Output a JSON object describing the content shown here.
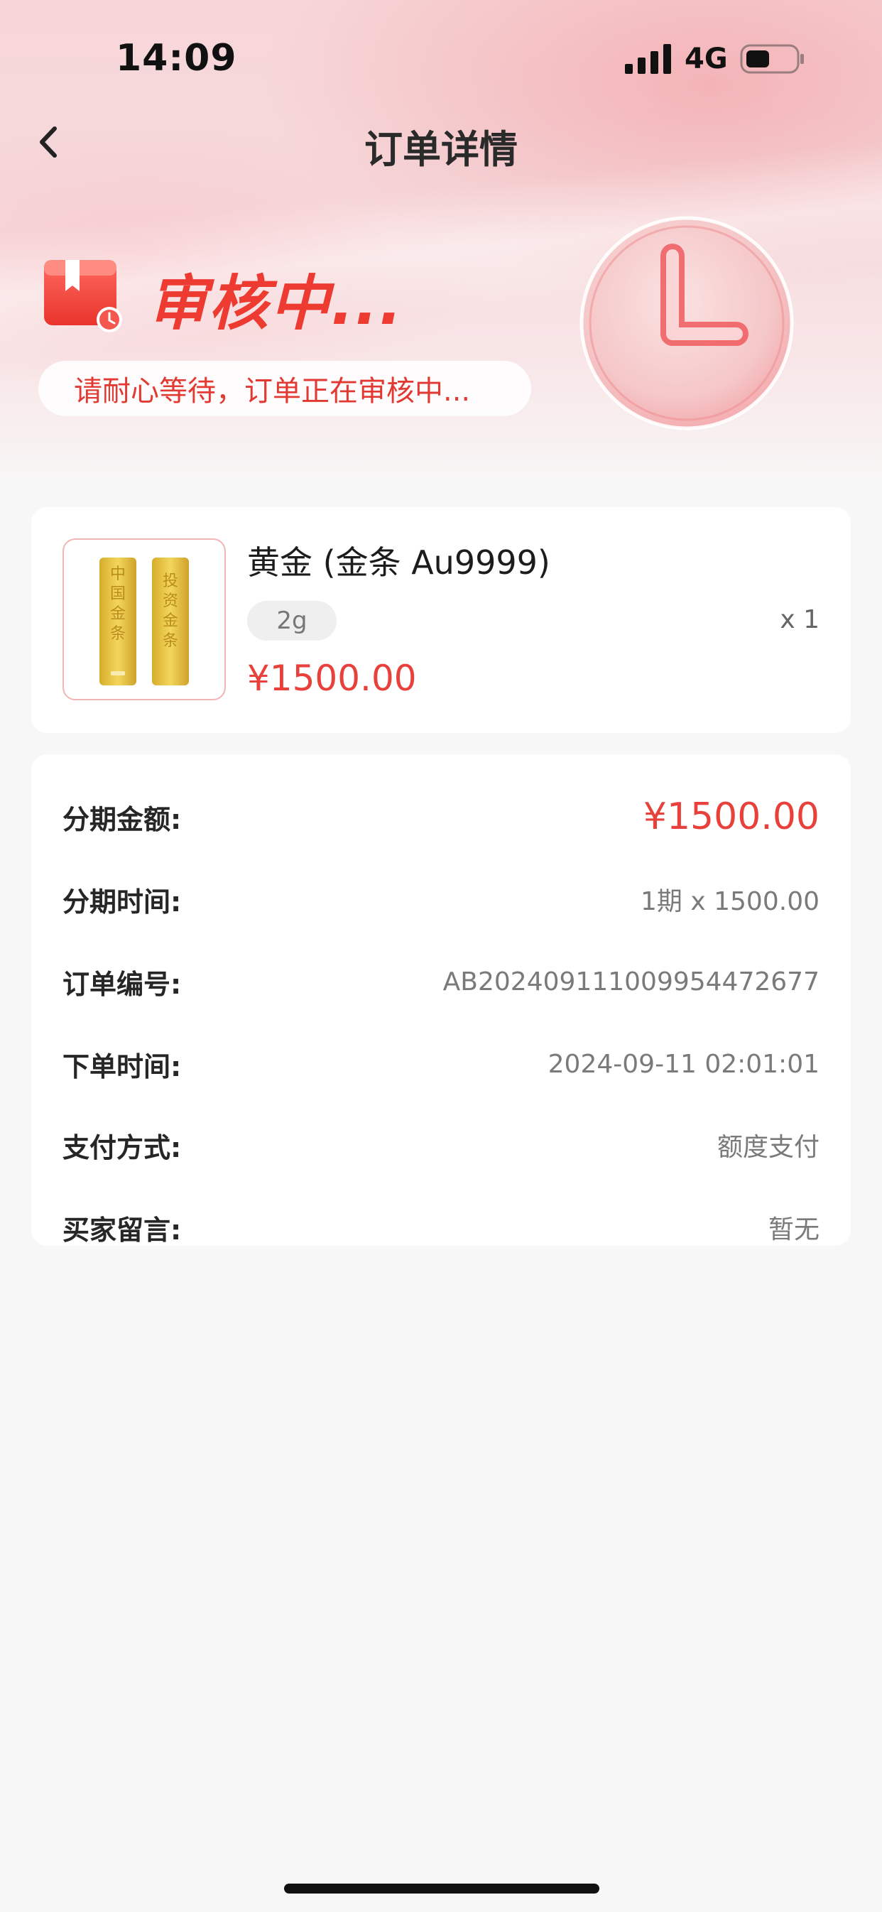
{
  "status_bar": {
    "time": "14:09",
    "network": "4G",
    "signal_icon": "signal-bars-icon",
    "battery_icon": "battery-icon"
  },
  "nav": {
    "back_icon": "chevron-left-icon",
    "title": "订单详情"
  },
  "order_status": {
    "icon": "package-clock-icon",
    "heading": "审核中...",
    "message": "请耐心等待，订单正在审核中...",
    "illustration": "clock-icon"
  },
  "product": {
    "name": "黄金 (金条 Au9999)",
    "spec": "2g",
    "quantity": "x 1",
    "price": "¥1500.00",
    "image_text_left": "中国金条",
    "image_text_right": "投资金条"
  },
  "details": [
    {
      "label": "分期金额:",
      "value": "¥1500.00",
      "highlight": true
    },
    {
      "label": "分期时间:",
      "value": "1期 x 1500.00"
    },
    {
      "label": "订单编号:",
      "value": "AB20240911100995447267​7"
    },
    {
      "label": "下单时间:",
      "value": "2024-09-11 02:01:01"
    },
    {
      "label": "支付方式:",
      "value": "额度支付"
    },
    {
      "label": "买家留言:",
      "value": "暂无"
    }
  ],
  "colors": {
    "accent": "#e8403a",
    "banner": "#f6dadc",
    "background": "#f7f7f7"
  }
}
